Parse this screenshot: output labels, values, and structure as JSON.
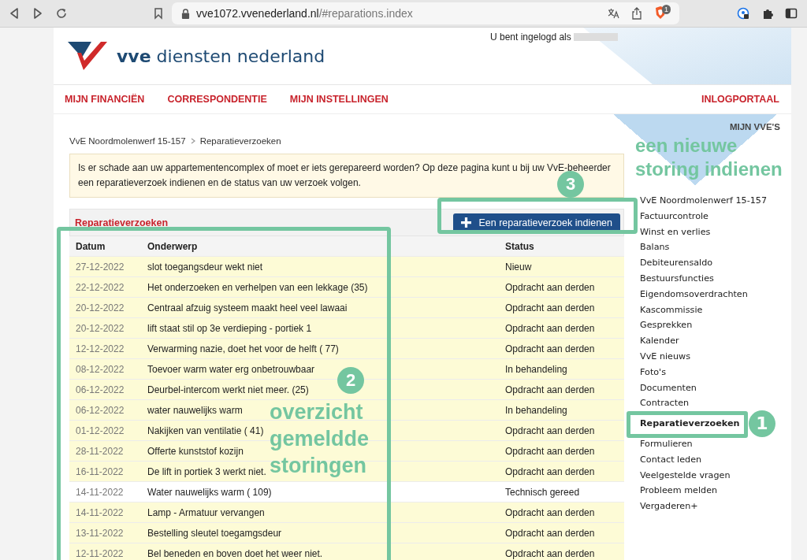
{
  "browser": {
    "url_host": "vve1072.vvenederland.nl",
    "url_path": "/#reparations.index",
    "shield_badge": "1"
  },
  "header": {
    "logo_bold": "vve",
    "logo_text": "diensten nederland",
    "login_label": "U bent ingelogd als"
  },
  "nav": {
    "items": [
      "MIJN FINANCIËN",
      "CORRESPONDENTIE",
      "MIJN INSTELLINGEN"
    ],
    "right": "INLOGPORTAAL"
  },
  "breadcrumb": [
    "VvE Noordmolenwerf 15-157",
    "Reparatieverzoeken"
  ],
  "intro": "Is er schade aan uw appartementencomplex of moet er iets gerepareerd worden? Op deze pagina kunt u bij uw VvE-beheerder een reparatieverzoek indienen en de status van uw verzoek volgen.",
  "panel": {
    "title": "Reparatieverzoeken",
    "button": "Een reparatieverzoek indienen"
  },
  "table": {
    "columns": [
      "Datum",
      "Onderwerp",
      "Status"
    ],
    "rows": [
      {
        "date": "27-12-2022",
        "subject": "slot toegangsdeur wekt niet",
        "status": "Nieuw",
        "completed": false
      },
      {
        "date": "22-12-2022",
        "subject": "Het onderzoeken en verhelpen van een lekkage (35)",
        "status": "Opdracht aan derden",
        "completed": false
      },
      {
        "date": "20-12-2022",
        "subject": "Centraal afzuig systeem maakt heel veel lawaai",
        "status": "Opdracht aan derden",
        "completed": false
      },
      {
        "date": "20-12-2022",
        "subject": "lift staat stil op 3e verdieping - portiek 1",
        "status": "Opdracht aan derden",
        "completed": false
      },
      {
        "date": "12-12-2022",
        "subject": "Verwarming nazie, doet het voor de helft ( 77)",
        "status": "Opdracht aan derden",
        "completed": false
      },
      {
        "date": "08-12-2022",
        "subject": "Toevoer warm water erg onbetrouwbaar",
        "status": "In behandeling",
        "completed": false
      },
      {
        "date": "06-12-2022",
        "subject": "Deurbel-intercom werkt niet meer. (25)",
        "status": "Opdracht aan derden",
        "completed": false
      },
      {
        "date": "06-12-2022",
        "subject": "water nauwelijks warm",
        "status": "In behandeling",
        "completed": false
      },
      {
        "date": "01-12-2022",
        "subject": "Nakijken van ventilatie ( 41)",
        "status": "Opdracht aan derden",
        "completed": false
      },
      {
        "date": "28-11-2022",
        "subject": "Offerte kunststof kozijn",
        "status": "Opdracht aan derden",
        "completed": false
      },
      {
        "date": "16-11-2022",
        "subject": "De lift in portiek 3 werkt niet.",
        "status": "Opdracht aan derden",
        "completed": false
      },
      {
        "date": "14-11-2022",
        "subject": "Water nauwelijks warm ( 109)",
        "status": "Technisch gereed",
        "completed": true
      },
      {
        "date": "14-11-2022",
        "subject": "Lamp - Armatuur vervangen",
        "status": "Opdracht aan derden",
        "completed": false
      },
      {
        "date": "13-11-2022",
        "subject": "Bestelling sleutel toegamgsdeur",
        "status": "Opdracht aan derden",
        "completed": false
      },
      {
        "date": "12-11-2022",
        "subject": "Bel beneden en boven doet het weer niet.",
        "status": "Opdracht aan derden",
        "completed": false
      }
    ]
  },
  "sidebar": {
    "title": "MIJN VVE'S",
    "items": [
      {
        "label": "VvE Noordmolenwerf 15-157",
        "selected": false
      },
      {
        "label": "Factuurcontrole",
        "selected": false
      },
      {
        "label": "Winst en verlies",
        "selected": false
      },
      {
        "label": "Balans",
        "selected": false
      },
      {
        "label": "Debiteurensaldo",
        "selected": false
      },
      {
        "label": "Bestuursfuncties",
        "selected": false
      },
      {
        "label": "Eigendomsoverdrachten",
        "selected": false
      },
      {
        "label": "Kascommissie",
        "selected": false
      },
      {
        "label": "Gesprekken",
        "selected": false
      },
      {
        "label": "Kalender",
        "selected": false
      },
      {
        "label": "VvE nieuws",
        "selected": false
      },
      {
        "label": "Foto's",
        "selected": false
      },
      {
        "label": "Documenten",
        "selected": false
      },
      {
        "label": "Contracten",
        "selected": false
      },
      {
        "label": "Reparatieverzoeken",
        "selected": true
      },
      {
        "label": "Formulieren",
        "selected": false
      },
      {
        "label": "Contact leden",
        "selected": false
      },
      {
        "label": "Veelgestelde vragen",
        "selected": false
      },
      {
        "label": "Probleem melden",
        "selected": false
      },
      {
        "label": "Vergaderen+",
        "selected": false
      }
    ]
  },
  "annotations": [
    {
      "number": "1"
    },
    {
      "number": "2",
      "text": "overzicht gemeldde storingen"
    },
    {
      "number": "3",
      "text": "een nieuwe storing indienen"
    }
  ]
}
